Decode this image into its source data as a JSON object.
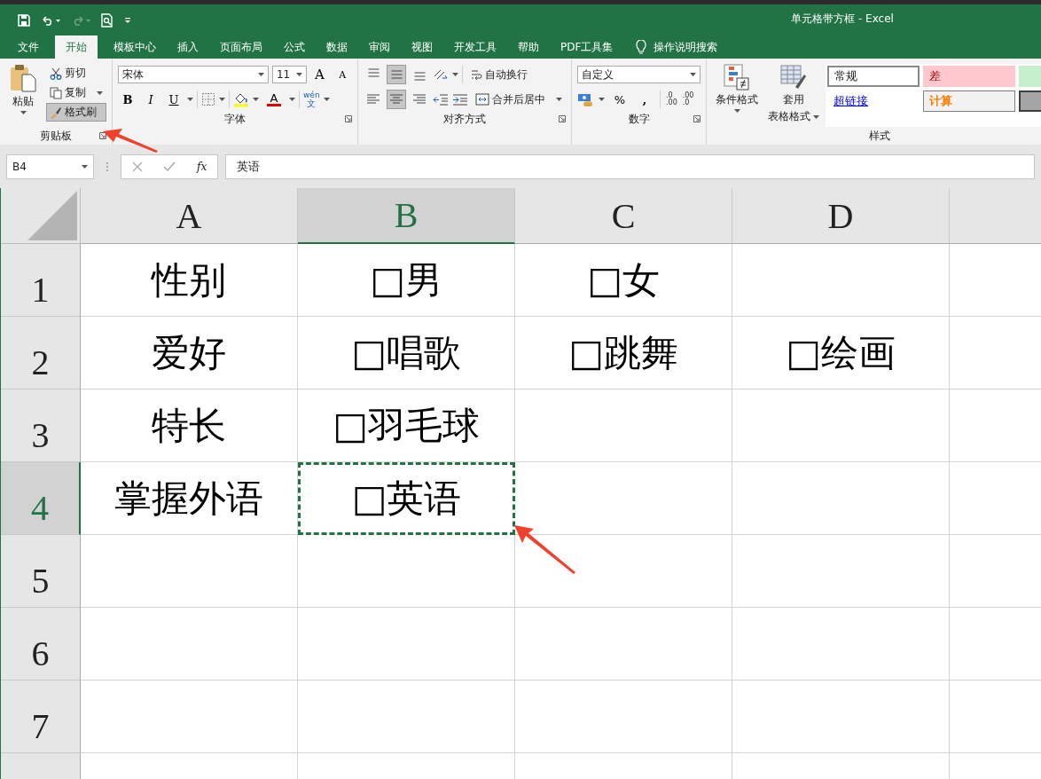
{
  "window": {
    "title": "单元格带方框 - Excel"
  },
  "tabs": [
    {
      "label": "文件",
      "selected": false
    },
    {
      "label": "开始",
      "selected": true
    },
    {
      "label": "模板中心",
      "selected": false
    },
    {
      "label": "插入",
      "selected": false
    },
    {
      "label": "页面布局",
      "selected": false
    },
    {
      "label": "公式",
      "selected": false
    },
    {
      "label": "数据",
      "selected": false
    },
    {
      "label": "审阅",
      "selected": false
    },
    {
      "label": "视图",
      "selected": false
    },
    {
      "label": "开发工具",
      "selected": false
    },
    {
      "label": "帮助",
      "selected": false
    },
    {
      "label": "PDF工具集",
      "selected": false
    }
  ],
  "tell_me": "操作说明搜索",
  "clipboard": {
    "paste": "粘贴",
    "cut": "剪切",
    "copy": "复制",
    "format_painter": {
      "label": "格式刷",
      "selected": true
    },
    "label": "剪贴板"
  },
  "font": {
    "name": "宋体",
    "size": "11",
    "grow": "A",
    "shrink": "A",
    "bold": "B",
    "italic": "I",
    "underline": "U",
    "color_glyph": "A",
    "phonetic": [
      "wén",
      "文"
    ],
    "label": "字体"
  },
  "alignment": {
    "vertical": [
      {
        "selected": false
      },
      {
        "selected": true
      },
      {
        "selected": false
      }
    ],
    "horizontal": [
      {
        "selected": false
      },
      {
        "selected": true
      },
      {
        "selected": false
      }
    ],
    "wrap": "自动换行",
    "merge": "合并后居中",
    "label": "对齐方式"
  },
  "number": {
    "format": "自定义",
    "percent": "%",
    "comma": ",",
    "increase_decimal": [
      ".0",
      ".00"
    ],
    "decrease_decimal": [
      ".00",
      ".0"
    ],
    "label": "数字"
  },
  "styles": {
    "conditional": "条件格式",
    "table_format": [
      "套用",
      "表格格式"
    ],
    "gallery": [
      {
        "kind": "normal",
        "text": "常规",
        "selected": true
      },
      {
        "kind": "bad",
        "text": "差",
        "selected": false
      },
      {
        "kind": "good",
        "selected": false
      },
      {
        "kind": "hyperlink",
        "text": "超链接",
        "selected": false
      },
      {
        "kind": "calc",
        "text": "计算",
        "selected": false
      },
      {
        "kind": "check",
        "selected": false
      }
    ],
    "label": "样式"
  },
  "formula_bar": {
    "name_box": "B4",
    "fx": "fx",
    "value": "英语"
  },
  "columns": [
    {
      "label": "A",
      "selected": false
    },
    {
      "label": "B",
      "selected": true
    },
    {
      "label": "C",
      "selected": false
    },
    {
      "label": "D",
      "selected": false
    }
  ],
  "rows": [
    {
      "label": "1",
      "selected": false,
      "cells": [
        {
          "text": "性别",
          "selected": false
        },
        {
          "text": "□男",
          "selected": false
        },
        {
          "text": "□女",
          "selected": false
        },
        {
          "selected": false
        }
      ]
    },
    {
      "label": "2",
      "selected": false,
      "cells": [
        {
          "text": "爱好",
          "selected": false
        },
        {
          "text": "□唱歌",
          "selected": false
        },
        {
          "text": "□跳舞",
          "selected": false
        },
        {
          "text": "□绘画",
          "selected": false
        }
      ]
    },
    {
      "label": "3",
      "selected": false,
      "cells": [
        {
          "text": "特长",
          "selected": false
        },
        {
          "text": "□羽毛球",
          "selected": false
        },
        {
          "selected": false
        },
        {
          "selected": false
        }
      ]
    },
    {
      "label": "4",
      "selected": true,
      "cells": [
        {
          "text": "掌握外语",
          "selected": false
        },
        {
          "text": "□英语",
          "selected": true
        },
        {
          "selected": false
        },
        {
          "selected": false
        }
      ]
    },
    {
      "label": "5",
      "selected": false,
      "cells": [
        {
          "selected": false
        },
        {
          "selected": false
        },
        {
          "selected": false
        },
        {
          "selected": false
        }
      ]
    },
    {
      "label": "6",
      "selected": false,
      "cells": [
        {
          "selected": false
        },
        {
          "selected": false
        },
        {
          "selected": false
        },
        {
          "selected": false
        }
      ]
    },
    {
      "label": "7",
      "selected": false,
      "cells": [
        {
          "selected": false
        },
        {
          "selected": false
        },
        {
          "selected": false
        },
        {
          "selected": false
        }
      ]
    },
    {
      "selected": false,
      "cells": [
        {
          "selected": false
        },
        {
          "selected": false
        },
        {
          "selected": false
        },
        {
          "selected": false
        }
      ]
    }
  ]
}
